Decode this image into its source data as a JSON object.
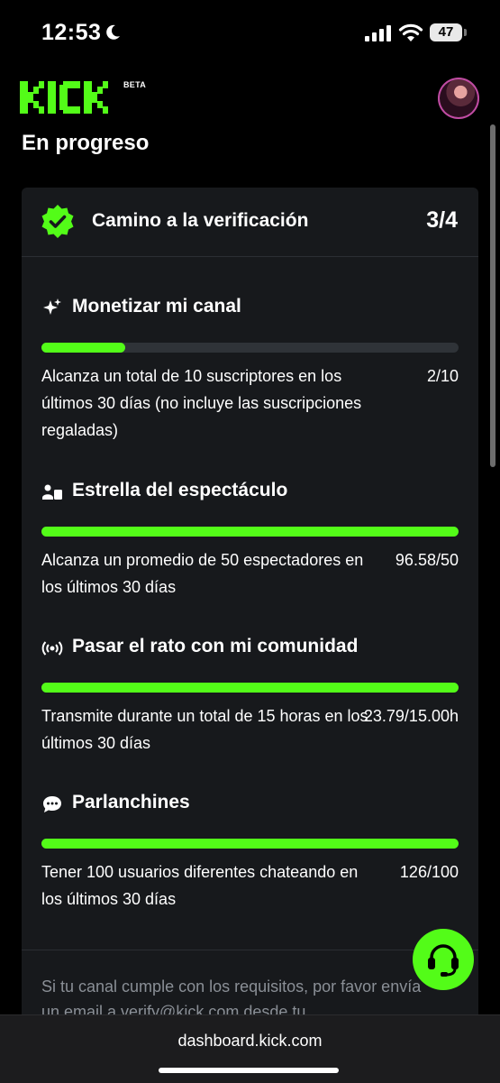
{
  "status_bar": {
    "time": "12:53",
    "battery": "47"
  },
  "header": {
    "logo_text": "KICK",
    "beta": "BETA"
  },
  "page_heading": "En progreso",
  "card": {
    "title": "Camino a la verificación",
    "count": "3/4",
    "sections": [
      {
        "icon": "sparkle-icon",
        "title": "Monetizar mi canal",
        "progress": 0.2,
        "description": "Alcanza un total de 10 suscriptores en los últimos 30 días (no incluye las suscripciones regaladas)",
        "value": "2/10"
      },
      {
        "icon": "viewers-icon",
        "title": "Estrella del espectáculo",
        "progress": 1.0,
        "description": "Alcanza un promedio de 50 espectadores en los últimos 30 días",
        "value": "96.58/50"
      },
      {
        "icon": "broadcast-icon",
        "title": "Pasar el rato con mi comunidad",
        "progress": 1.0,
        "description": "Transmite durante un total de 15 horas en los últimos 30 días",
        "value": "23.79/15.00h"
      },
      {
        "icon": "chat-icon",
        "title": "Parlanchines",
        "progress": 1.0,
        "description": "Tener 100 usuarios diferentes chateando en los últimos 30 días",
        "value": "126/100"
      }
    ],
    "footer": "Si tu canal cumple con los requisitos, por favor envía un email a verify@kick.com desde tu"
  },
  "browser": {
    "url": "dashboard.kick.com"
  },
  "colors": {
    "accent": "#53fc18",
    "card_bg": "#17191c",
    "track": "#2f3338"
  }
}
